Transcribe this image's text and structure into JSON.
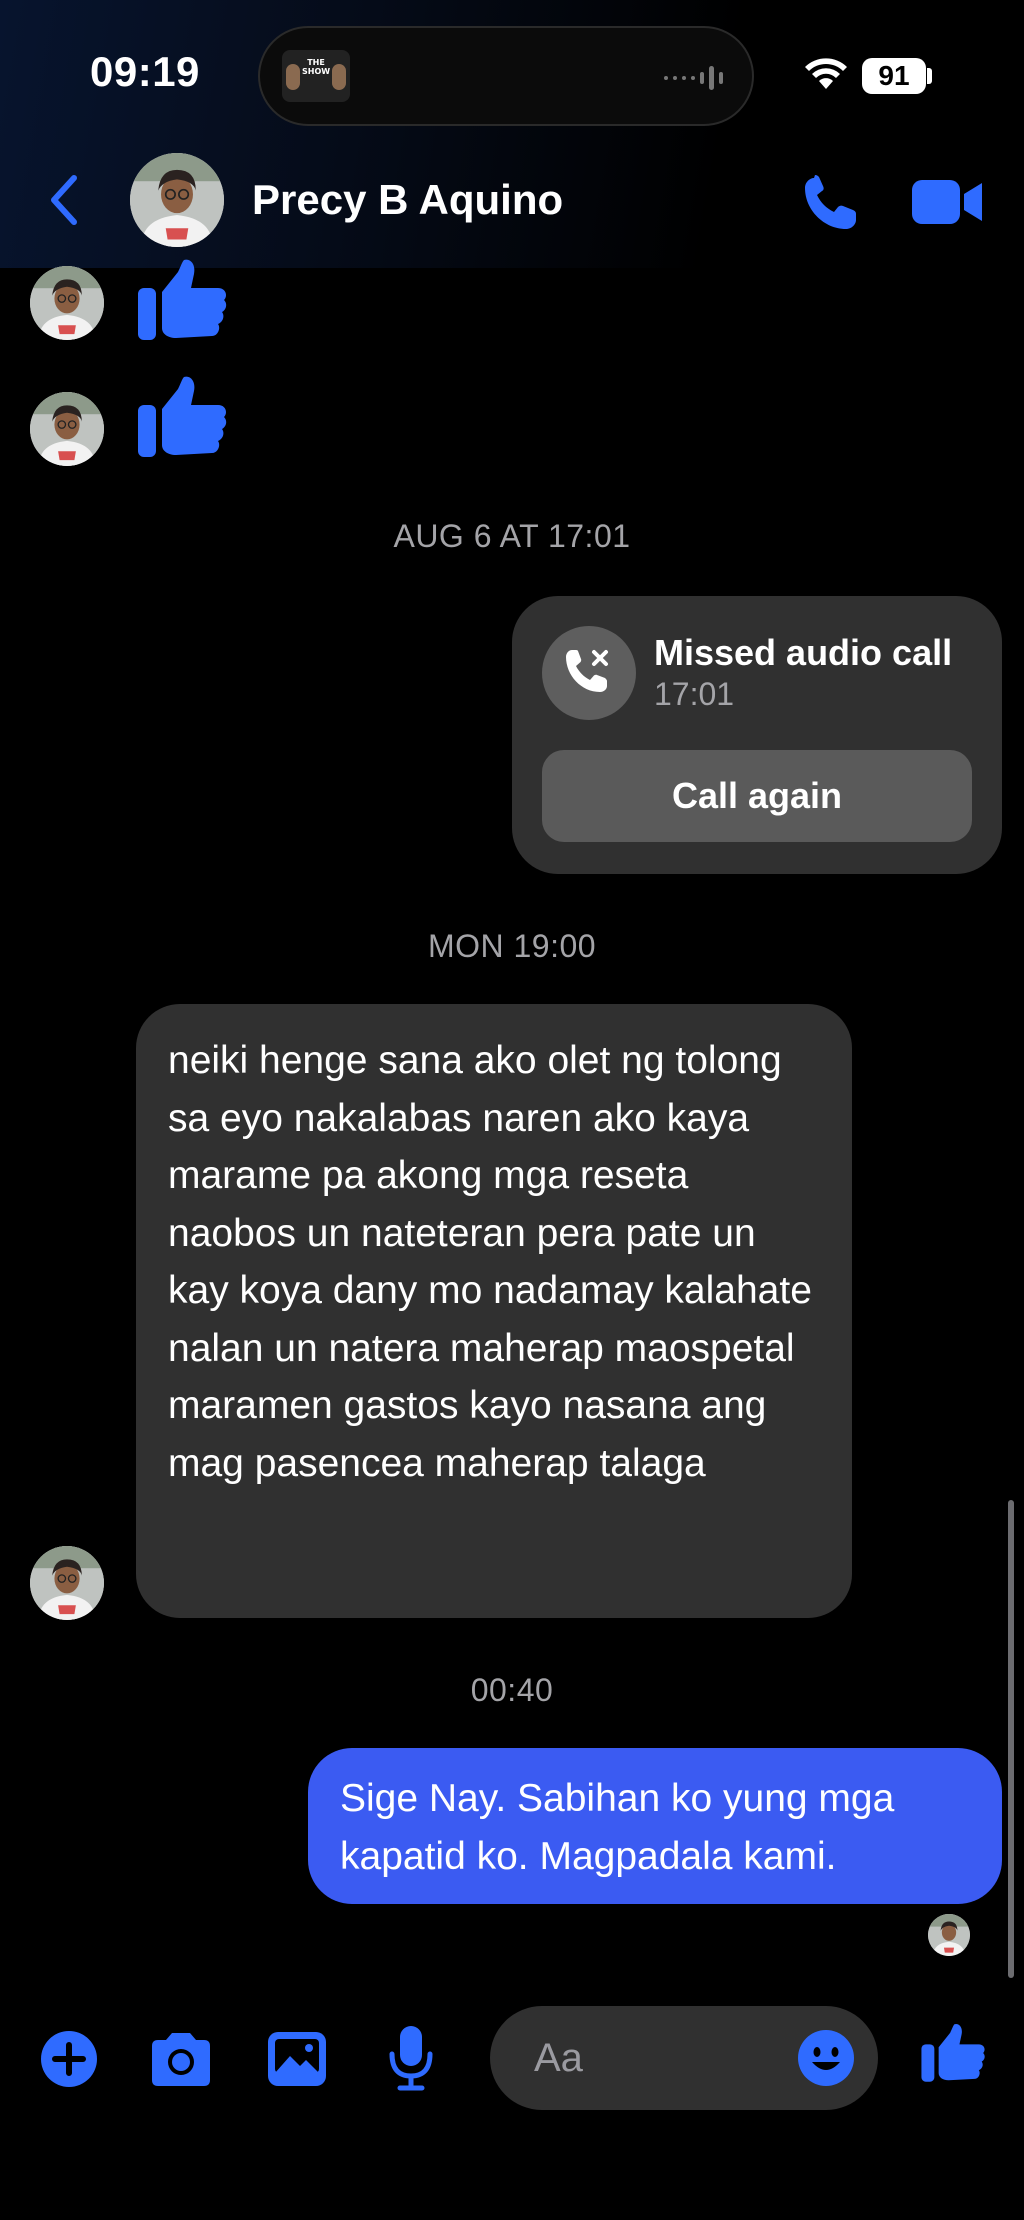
{
  "status_bar": {
    "time": "09:19",
    "battery": "91",
    "island_art_label": "THE SHOW"
  },
  "header": {
    "contact_name": "Precy B Aquino"
  },
  "messages": {
    "timestamp_1": "AUG 6 AT 17:01",
    "missed_call": {
      "title": "Missed audio call",
      "time": "17:01",
      "button_label": "Call again"
    },
    "timestamp_2": "MON 19:00",
    "incoming_text": "neiki henge sana ako olet ng tolong sa eyo nakalabas naren ako kaya marame pa akong mga reseta naobos un nateteran pera pate un kay koya dany mo nadamay kalahate nalan un natera maherap maospetal maramen gastos kayo nasana ang mag pasencea maherap talaga",
    "timestamp_3": "00:40",
    "outgoing_text": "Sige Nay. Sabihan ko yung mga kapatid ko. Magpadala kami."
  },
  "composer": {
    "placeholder": "Aa"
  },
  "colors": {
    "accent": "#3b5bf2",
    "icon_blue": "#2f6bff",
    "bubble_gray": "#303030",
    "background": "#000000"
  },
  "icons": [
    "back-chevron-icon",
    "phone-icon",
    "video-camera-icon",
    "thumbs-up-icon",
    "missed-call-icon",
    "plus-icon",
    "camera-icon",
    "photo-icon",
    "microphone-icon",
    "emoji-icon"
  ]
}
